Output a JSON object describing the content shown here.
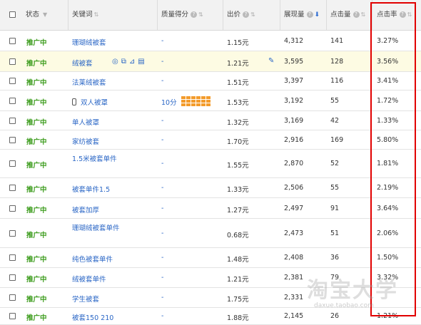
{
  "header": {
    "status": "状态",
    "keyword": "关键词",
    "quality": "质量得分",
    "bid": "出价",
    "impressions": "展现量",
    "clicks": "点击量",
    "ctr": "点击率"
  },
  "rows": [
    {
      "status": "推广中",
      "keyword": "珊瑚绒被套",
      "quality": "-",
      "bid": "1.15元",
      "impressions": "4,312",
      "clicks": "141",
      "ctr": "3.27%"
    },
    {
      "status": "推广中",
      "keyword": "绒被套",
      "quality": "-",
      "bid": "1.21元",
      "impressions": "3,595",
      "clicks": "128",
      "ctr": "3.56%",
      "highlight": true
    },
    {
      "status": "推广中",
      "keyword": "法莱绒被套",
      "quality": "-",
      "bid": "1.51元",
      "impressions": "3,397",
      "clicks": "116",
      "ctr": "3.41%"
    },
    {
      "status": "推广中",
      "keyword": "双人被罩",
      "quality": "10分",
      "bid": "1.53元",
      "impressions": "3,192",
      "clicks": "55",
      "ctr": "1.72%",
      "mobile": true
    },
    {
      "status": "推广中",
      "keyword": "单人被罩",
      "quality": "-",
      "bid": "1.32元",
      "impressions": "3,169",
      "clicks": "42",
      "ctr": "1.33%"
    },
    {
      "status": "推广中",
      "keyword": "家纺被套",
      "quality": "-",
      "bid": "1.70元",
      "impressions": "2,916",
      "clicks": "169",
      "ctr": "5.80%"
    },
    {
      "status": "推广中",
      "keyword": "1.5米被套单件",
      "quality": "-",
      "bid": "1.55元",
      "impressions": "2,870",
      "clicks": "52",
      "ctr": "1.81%"
    },
    {
      "status": "推广中",
      "keyword": "被套单件1.5",
      "quality": "-",
      "bid": "1.33元",
      "impressions": "2,506",
      "clicks": "55",
      "ctr": "2.19%"
    },
    {
      "status": "推广中",
      "keyword": "被套加厚",
      "quality": "-",
      "bid": "1.27元",
      "impressions": "2,497",
      "clicks": "91",
      "ctr": "3.64%"
    },
    {
      "status": "推广中",
      "keyword": "珊瑚绒被套单件",
      "quality": "-",
      "bid": "0.68元",
      "impressions": "2,473",
      "clicks": "51",
      "ctr": "2.06%"
    },
    {
      "status": "推广中",
      "keyword": "纯色被套单件",
      "quality": "-",
      "bid": "1.48元",
      "impressions": "2,408",
      "clicks": "36",
      "ctr": "1.50%"
    },
    {
      "status": "推广中",
      "keyword": "绒被套单件",
      "quality": "-",
      "bid": "1.21元",
      "impressions": "2,381",
      "clicks": "79",
      "ctr": "3.32%"
    },
    {
      "status": "推广中",
      "keyword": "学生被套",
      "quality": "-",
      "bid": "1.75元",
      "impressions": "2,331",
      "clicks": "",
      "ctr": ""
    },
    {
      "status": "推广中",
      "keyword": "被套150 210",
      "quality": "-",
      "bid": "1.88元",
      "impressions": "2,145",
      "clicks": "26",
      "ctr": "1.21%"
    }
  ],
  "row_actions_icons": [
    "target-icon",
    "copy-icon",
    "chart-icon",
    "trash-icon"
  ],
  "quality_bar_level": 10,
  "watermark": "淘宝大学",
  "watermark_sub": "daxue.taobao.com",
  "colors": {
    "status": "#3a9b1a",
    "link": "#2b67c6",
    "highlight_box": "#e10000",
    "quality_bars": "#f39b2b"
  }
}
